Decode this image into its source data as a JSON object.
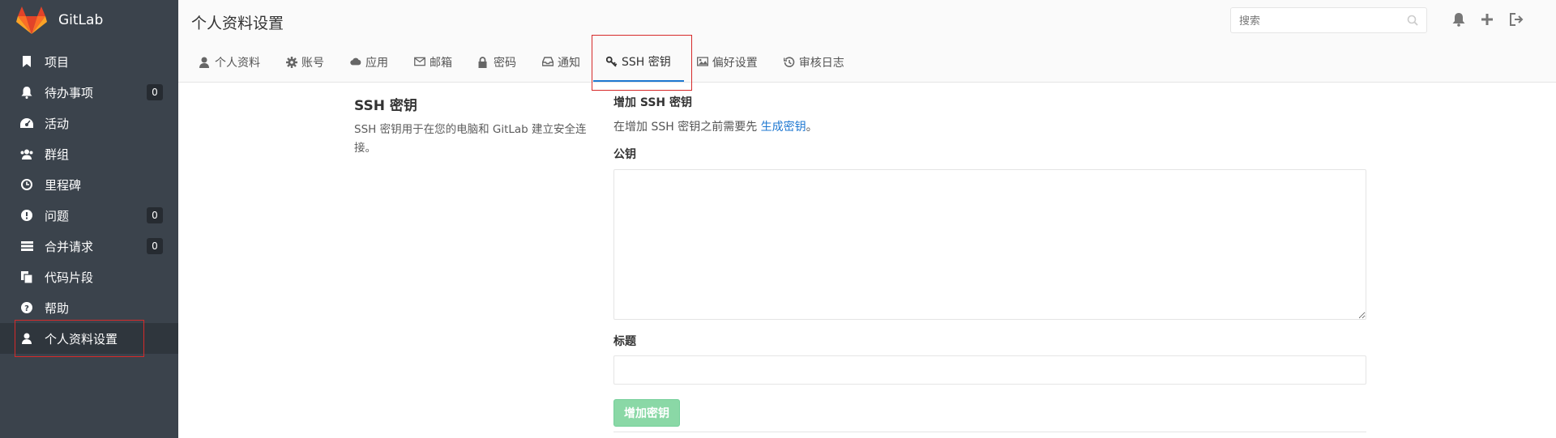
{
  "app": {
    "name": "GitLab",
    "brand_colors": [
      "#e24329",
      "#fc6d26",
      "#fca326"
    ]
  },
  "sidebar": {
    "items": [
      {
        "label": "项目",
        "icon": "bookmark-icon"
      },
      {
        "label": "待办事项",
        "icon": "bell-icon",
        "count": "0"
      },
      {
        "label": "活动",
        "icon": "dashboard-icon"
      },
      {
        "label": "群组",
        "icon": "users-icon"
      },
      {
        "label": "里程碑",
        "icon": "clock-icon"
      },
      {
        "label": "问题",
        "icon": "exclamation-circle-icon",
        "count": "0"
      },
      {
        "label": "合并请求",
        "icon": "list-icon",
        "count": "0"
      },
      {
        "label": "代码片段",
        "icon": "clipboard-icon"
      },
      {
        "label": "帮助",
        "icon": "question-circle-icon"
      },
      {
        "label": "个人资料设置",
        "icon": "user-icon",
        "active": true
      }
    ]
  },
  "header": {
    "title": "个人资料设置",
    "search_placeholder": "搜索",
    "tabs": [
      {
        "label": "个人资料",
        "icon": "user-icon"
      },
      {
        "label": "账号",
        "icon": "gear-icon"
      },
      {
        "label": "应用",
        "icon": "cloud-icon"
      },
      {
        "label": "邮箱",
        "icon": "envelope-icon"
      },
      {
        "label": "密码",
        "icon": "lock-icon"
      },
      {
        "label": "通知",
        "icon": "inbox-icon"
      },
      {
        "label": "SSH 密钥",
        "icon": "key-icon",
        "active": true
      },
      {
        "label": "偏好设置",
        "icon": "image-icon"
      },
      {
        "label": "审核日志",
        "icon": "history-icon"
      }
    ]
  },
  "main": {
    "section_title": "SSH 密钥",
    "section_desc": "SSH 密钥用于在您的电脑和 GitLab 建立安全连接。",
    "form_heading": "增加 SSH 密钥",
    "hint_prefix": "在增加 SSH 密钥之前需要先 ",
    "hint_link": "生成密钥",
    "hint_suffix": "。",
    "key_label": "公钥",
    "key_value": "",
    "title_label": "标题",
    "title_value": "",
    "submit_label": "增加密钥"
  },
  "colors": {
    "accent": "#1f78d1",
    "sidebar_bg": "#3b434c",
    "success_disabled": "#8ad8a6",
    "highlight_box": "#d62a2a"
  }
}
